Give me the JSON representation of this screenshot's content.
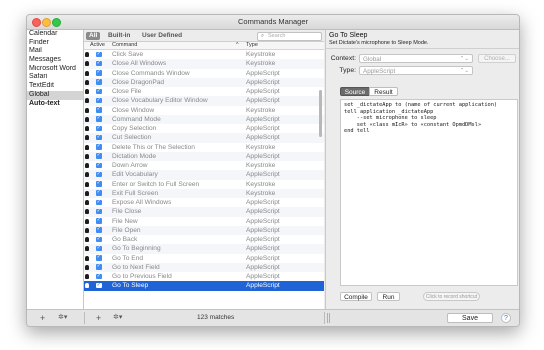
{
  "window": {
    "title": "Commands Manager"
  },
  "apps": [
    {
      "label": "Calendar"
    },
    {
      "label": "Finder"
    },
    {
      "label": "Mail"
    },
    {
      "label": "Messages"
    },
    {
      "label": "Microsoft Word"
    },
    {
      "label": "Safari"
    },
    {
      "label": "TextEdit"
    },
    {
      "label": "Global",
      "selected": true
    },
    {
      "label": "Auto-text",
      "bold": true
    }
  ],
  "filter": {
    "tabs": [
      "All",
      "Built-in",
      "User Defined"
    ],
    "search_placeholder": "Search"
  },
  "columns": {
    "active": "Active",
    "command": "Command",
    "sort_arrow": "^",
    "type": "Type"
  },
  "commands": [
    {
      "name": "Click Save",
      "type": "Keystroke"
    },
    {
      "name": "Close All Windows",
      "type": "Keystroke"
    },
    {
      "name": "Close Commands Window",
      "type": "AppleScript"
    },
    {
      "name": "Close DragonPad",
      "type": "AppleScript"
    },
    {
      "name": "Close File",
      "type": "AppleScript"
    },
    {
      "name": "Close Vocabulary Editor Window",
      "type": "AppleScript"
    },
    {
      "name": "Close Window",
      "type": "Keystroke"
    },
    {
      "name": "Command Mode",
      "type": "AppleScript"
    },
    {
      "name": "Copy Selection",
      "type": "AppleScript"
    },
    {
      "name": "Cut Selection",
      "type": "AppleScript"
    },
    {
      "name": "Delete This or The Selection",
      "type": "Keystroke"
    },
    {
      "name": "Dictation Mode",
      "type": "AppleScript"
    },
    {
      "name": "Down Arrow",
      "type": "Keystroke"
    },
    {
      "name": "Edit Vocabulary",
      "type": "AppleScript"
    },
    {
      "name": "Enter or Switch to Full Screen",
      "type": "Keystroke"
    },
    {
      "name": "Exit Full Screen",
      "type": "Keystroke"
    },
    {
      "name": "Expose All Windows",
      "type": "AppleScript"
    },
    {
      "name": "File Close",
      "type": "AppleScript"
    },
    {
      "name": "File New",
      "type": "AppleScript"
    },
    {
      "name": "File Open",
      "type": "AppleScript"
    },
    {
      "name": "Go Back",
      "type": "AppleScript"
    },
    {
      "name": "Go To Beginning",
      "type": "AppleScript"
    },
    {
      "name": "Go To End",
      "type": "AppleScript"
    },
    {
      "name": "Go to Next Field",
      "type": "AppleScript"
    },
    {
      "name": "Go to Previous Field",
      "type": "AppleScript"
    },
    {
      "name": "Go To Sleep",
      "type": "AppleScript",
      "selected": true
    }
  ],
  "detail": {
    "title": "Go To Sleep",
    "subtitle": "Set Dictate's microphone to Sleep Mode.",
    "context_label": "Context:",
    "context_value": "Global",
    "type_label": "Type:",
    "type_value": "AppleScript",
    "choose_label": "Choose...",
    "tab_source": "Source",
    "tab_result": "Result",
    "script": "set _dictateApp to (name of current application)\ntell application _dictateApp\n    --set microphone to sleep\n    set «class mIcR» to «constant OpmdDMsl»\nend tell",
    "compile_label": "Compile",
    "run_label": "Run",
    "shortcut_label": "Click to record shortcut"
  },
  "bottom": {
    "add_label": "+",
    "gear_label": "✲▾",
    "matches": "123 matches",
    "save_label": "Save",
    "help_label": "?"
  }
}
